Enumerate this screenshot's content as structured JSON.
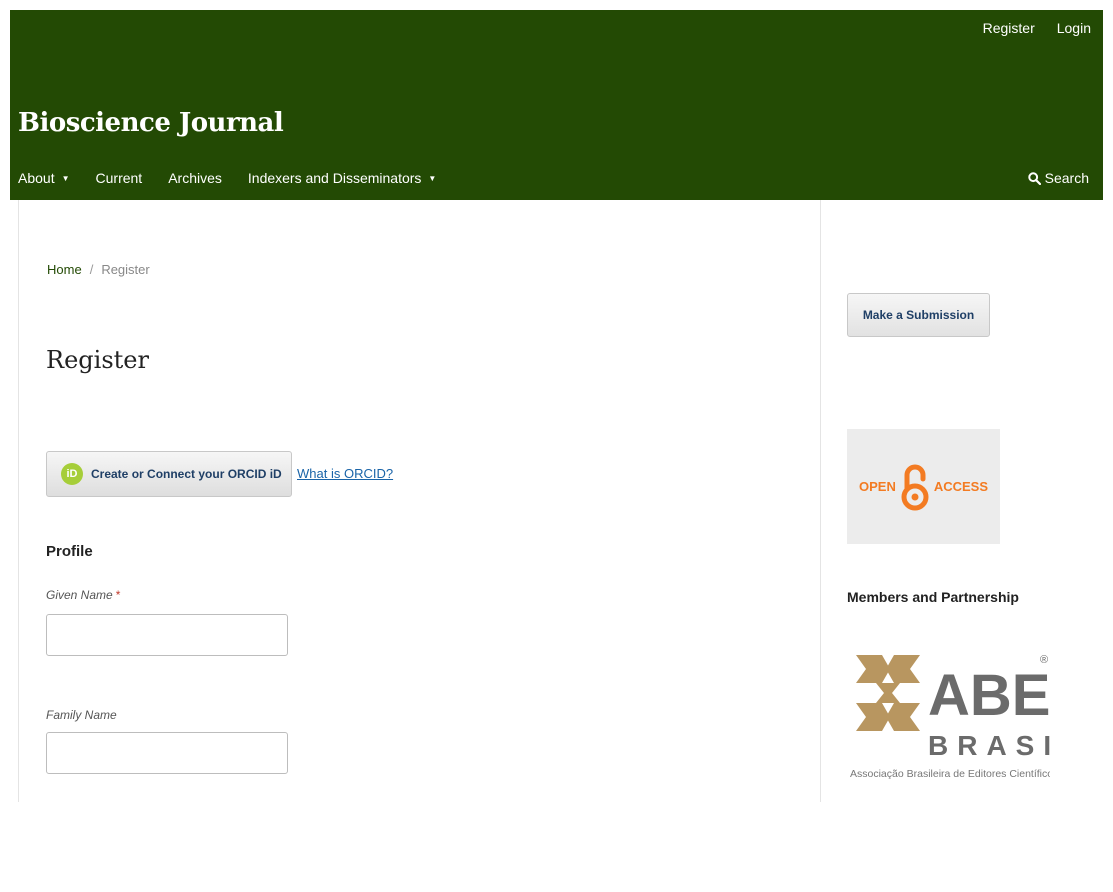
{
  "header": {
    "user_nav": {
      "register": "Register",
      "login": "Login"
    },
    "site_title": "Bioscience Journal",
    "nav": {
      "about": "About",
      "current": "Current",
      "archives": "Archives",
      "indexers": "Indexers and Disseminators"
    },
    "search_label": "Search",
    "colors": {
      "background": "#234a04",
      "text": "#ffffff"
    }
  },
  "breadcrumb": {
    "home": "Home",
    "separator": "/",
    "current": "Register"
  },
  "page_title": "Register",
  "orcid": {
    "icon_text": "iD",
    "button_label": "Create or Connect your ORCID iD",
    "link_label": "What is ORCID?"
  },
  "form": {
    "section_title": "Profile",
    "given_name_label": "Given Name",
    "required_marker": "*",
    "given_name_value": "",
    "family_name_label": "Family Name",
    "family_name_value": ""
  },
  "sidebar": {
    "submission_button": "Make a Submission",
    "open_access": {
      "left": "OPEN",
      "right": "ACCESS"
    },
    "members_heading": "Members and Partnership",
    "abec": {
      "main": "ABEC",
      "country": "BRASIL",
      "registered": "®",
      "caption": "Associação Brasileira de Editores Científicos"
    }
  }
}
